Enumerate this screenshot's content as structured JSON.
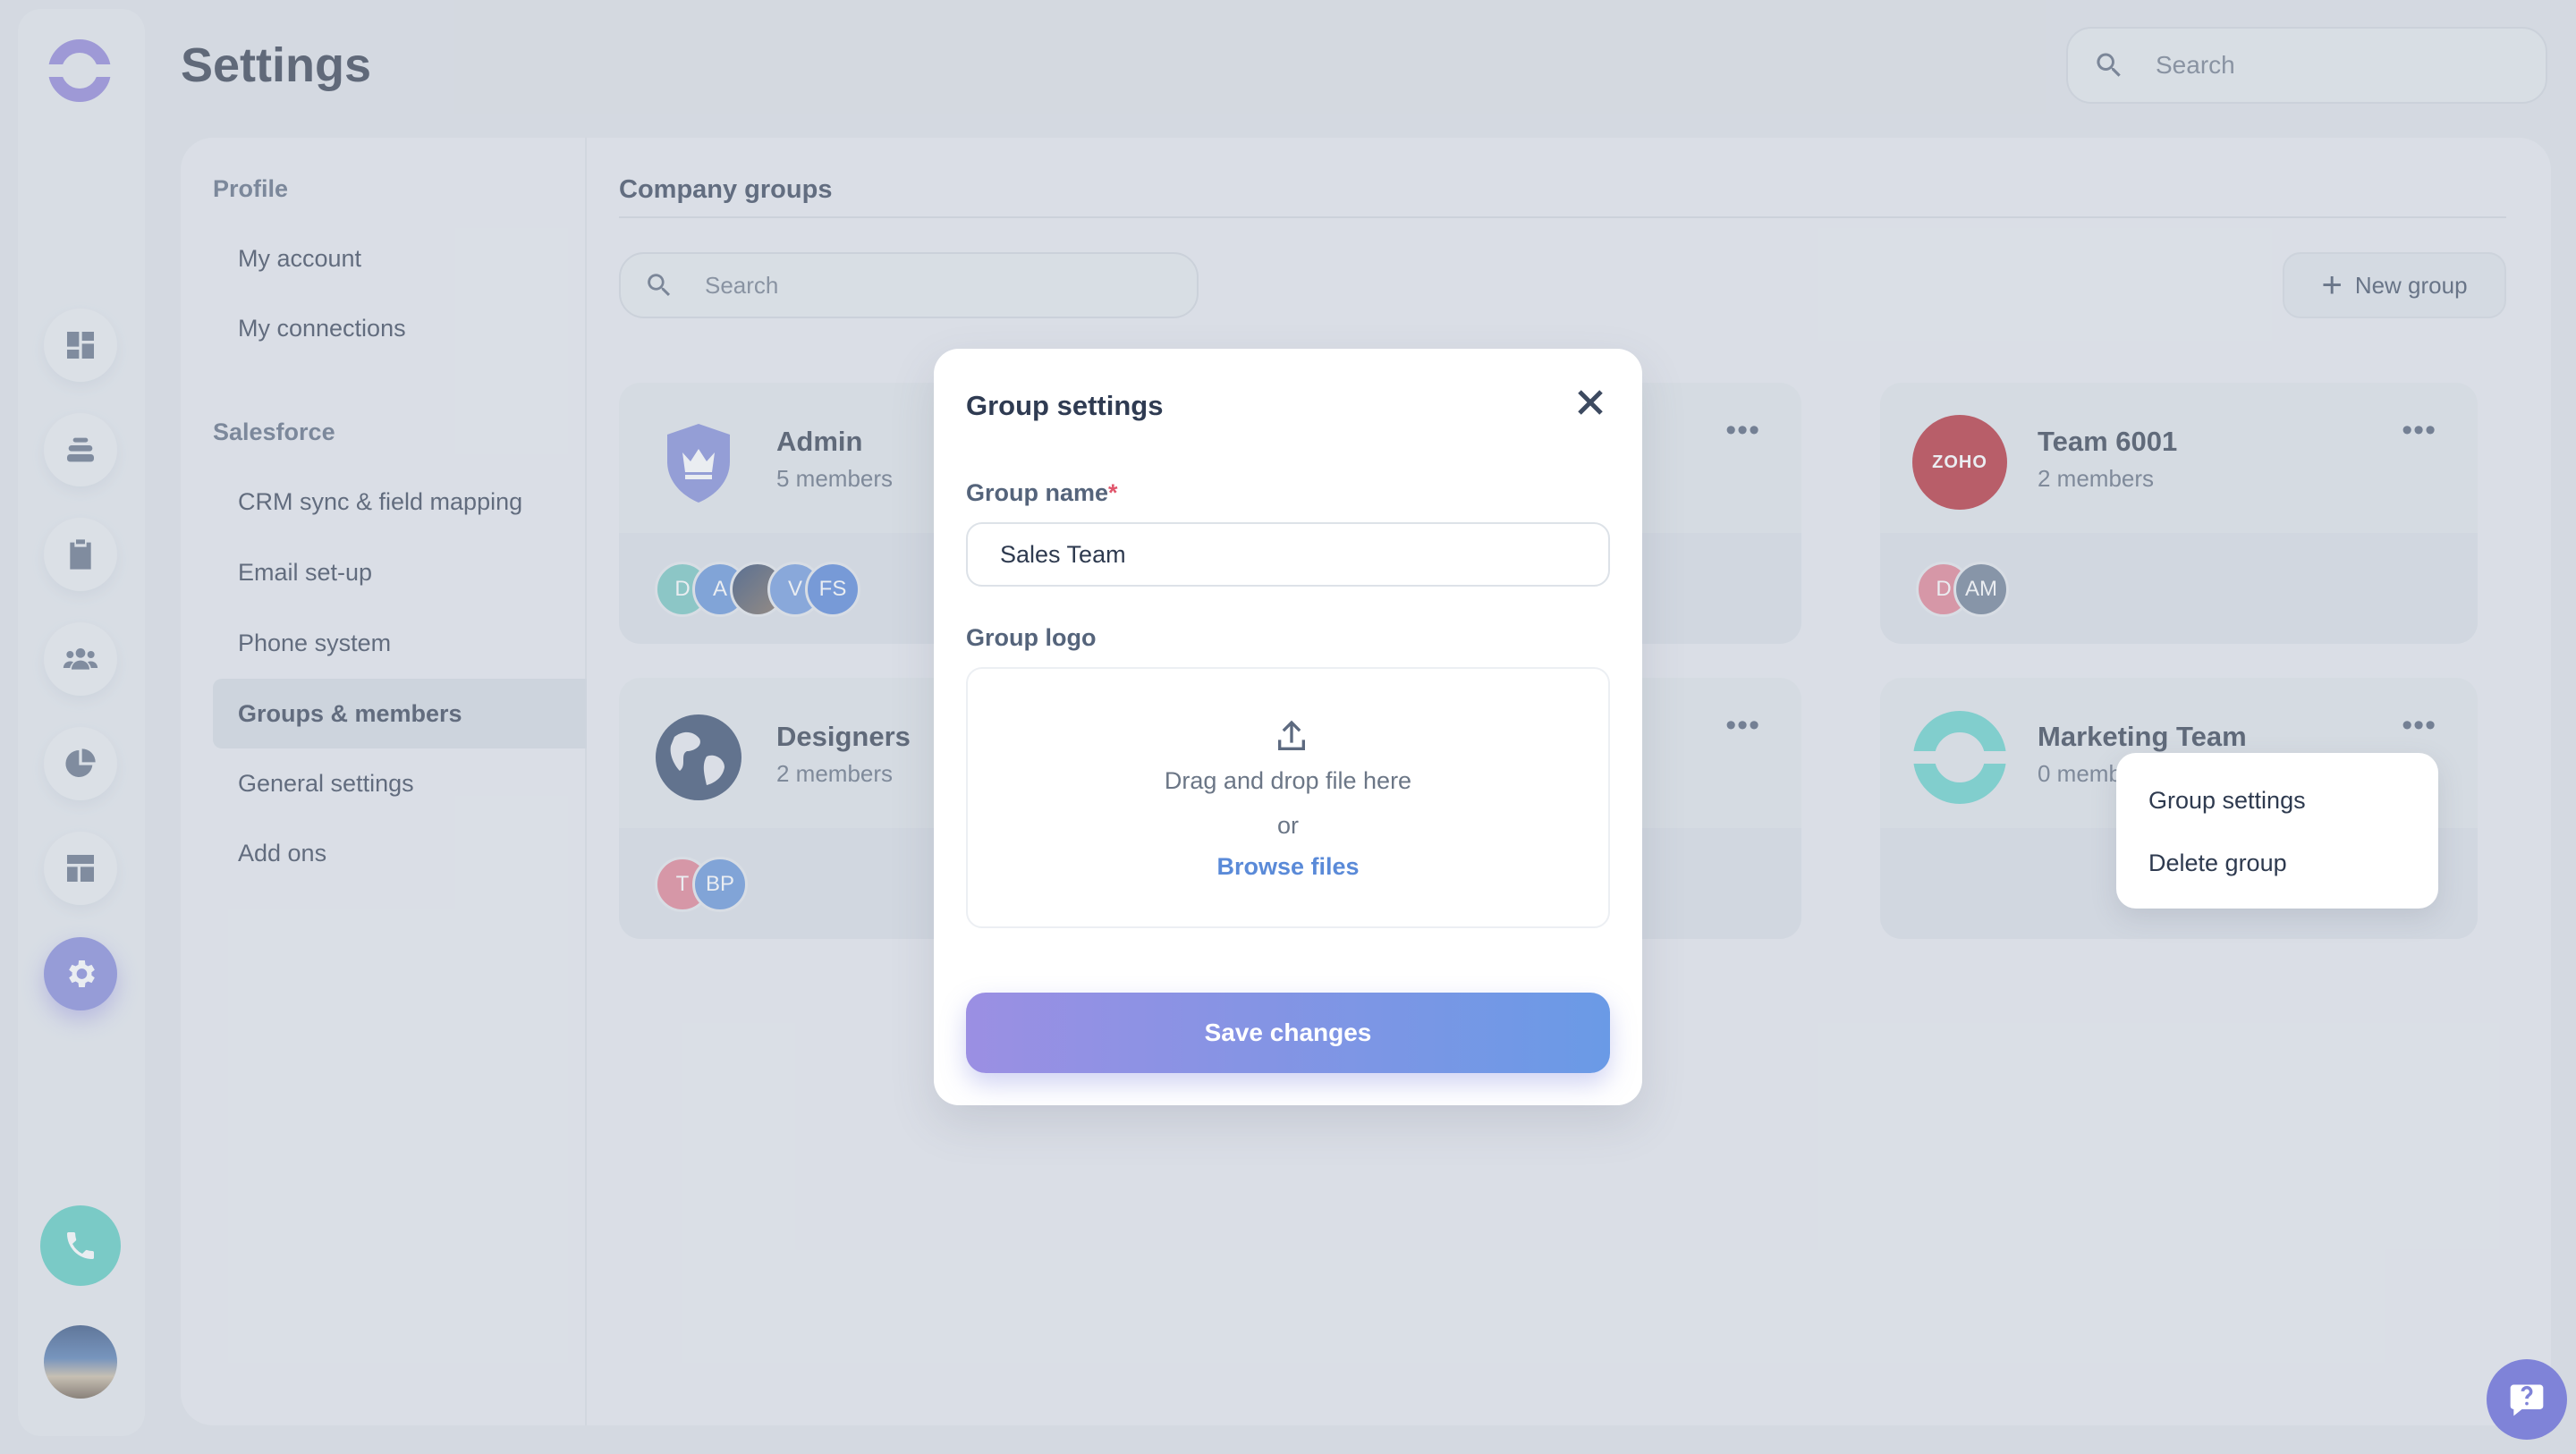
{
  "header": {
    "title": "Settings",
    "search_placeholder": "Search"
  },
  "settings_nav": {
    "sections": [
      {
        "label": "Profile",
        "items": [
          "My account",
          "My connections"
        ]
      },
      {
        "label": "Salesforce",
        "items": [
          "CRM sync & field mapping",
          "Email set-up",
          "Phone system",
          "Groups & members",
          "General settings",
          "Add ons"
        ]
      }
    ],
    "active_item": "Groups & members"
  },
  "content": {
    "title": "Company groups",
    "search_placeholder": "Search",
    "new_group_label": "New group"
  },
  "groups": [
    {
      "name": "Admin",
      "members": "5 members",
      "avatars": [
        "D",
        "A",
        "",
        "V",
        "FS"
      ]
    },
    {
      "name": "Team 6001",
      "members": "2 members",
      "avatars": [
        "D",
        "AM"
      ],
      "logo_text": "ZOHO"
    },
    {
      "name": "Designers",
      "members": "2 members",
      "avatars": [
        "T",
        "BP"
      ]
    },
    {
      "name": "Marketing Team",
      "members": "0 memb"
    }
  ],
  "modal": {
    "title": "Group settings",
    "name_label": "Group name",
    "required_mark": "*",
    "name_value": "Sales Team",
    "logo_label": "Group logo",
    "drop_text": "Drag and drop file here",
    "or_text": "or",
    "browse_text": "Browse files",
    "save_label": "Save changes"
  },
  "context_menu": {
    "items": [
      "Group settings",
      "Delete group"
    ]
  },
  "colors": {
    "accent": "#7f83d8",
    "teal": "#54c9bd",
    "link": "#5a8ad8"
  }
}
